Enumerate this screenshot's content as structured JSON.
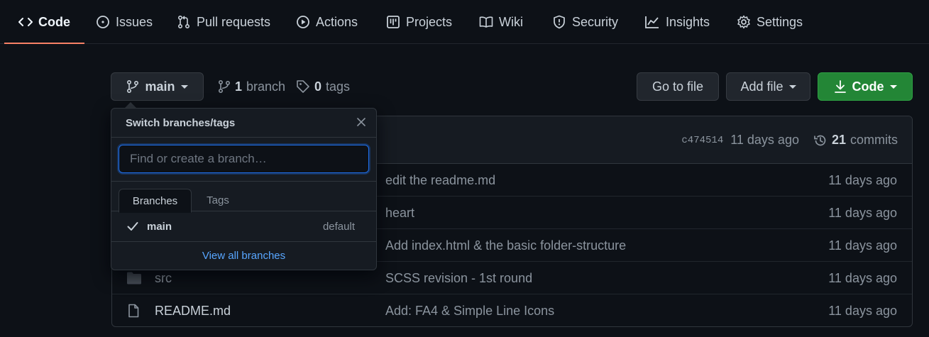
{
  "tabs": [
    {
      "label": "Code",
      "icon": "code-icon"
    },
    {
      "label": "Issues",
      "icon": "issue-icon"
    },
    {
      "label": "Pull requests",
      "icon": "pull-request-icon"
    },
    {
      "label": "Actions",
      "icon": "play-icon"
    },
    {
      "label": "Projects",
      "icon": "project-icon"
    },
    {
      "label": "Wiki",
      "icon": "book-icon"
    },
    {
      "label": "Security",
      "icon": "shield-icon"
    },
    {
      "label": "Insights",
      "icon": "graph-icon"
    },
    {
      "label": "Settings",
      "icon": "gear-icon"
    }
  ],
  "toolbar": {
    "branch_button": "main",
    "branch_count": "1",
    "branch_label": "branch",
    "tag_count": "0",
    "tag_label": "tags",
    "go_to_file": "Go to file",
    "add_file": "Add file",
    "code_button": "Code"
  },
  "latest_commit": {
    "sha": "c474514",
    "date": "11 days ago",
    "commit_count": "21",
    "commit_label": "commits"
  },
  "files": [
    {
      "name": "",
      "type": "file",
      "message": "edit the readme.md",
      "date": "11 days ago"
    },
    {
      "name": "",
      "type": "file",
      "message": "heart",
      "date": "11 days ago"
    },
    {
      "name": "",
      "type": "file",
      "message": "Add index.html & the basic folder-structure",
      "date": "11 days ago"
    },
    {
      "name": "src",
      "type": "directory",
      "message": "SCSS revision - 1st round",
      "date": "11 days ago"
    },
    {
      "name": "README.md",
      "type": "file",
      "message": "Add: FA4 & Simple Line Icons",
      "date": "11 days ago"
    }
  ],
  "branch_dropdown": {
    "title": "Switch branches/tags",
    "filter_placeholder": "Find or create a branch…",
    "filter_value": "",
    "tab_branches": "Branches",
    "tab_tags": "Tags",
    "branches": [
      {
        "name": "main",
        "badge": "default",
        "selected": true
      }
    ],
    "footer_link": "View all branches"
  },
  "colors": {
    "background": "#0d1117",
    "active_tab_underline": "#f78166",
    "green_button": "#238636",
    "link_blue": "#58a6ff",
    "focus_border": "#1f6feb"
  }
}
